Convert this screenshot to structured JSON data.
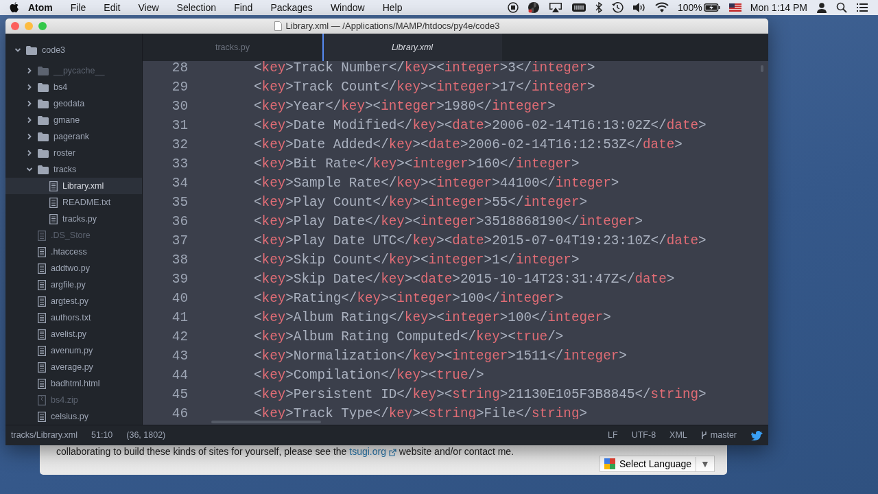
{
  "menu_bar": {
    "app": "Atom",
    "items": [
      "File",
      "Edit",
      "View",
      "Selection",
      "Find",
      "Packages",
      "Window",
      "Help"
    ],
    "battery": "100%",
    "clock": "Mon 1:14 PM"
  },
  "window": {
    "title": "Library.xml — /Applications/MAMP/htdocs/py4e/code3"
  },
  "sidebar": {
    "root": {
      "label": "code3",
      "expanded": true,
      "children": [
        {
          "label": "__pycache__",
          "kind": "folder",
          "expanded": false,
          "dimmed": true,
          "selected": false
        },
        {
          "label": "bs4",
          "kind": "folder",
          "expanded": false,
          "dimmed": false,
          "selected": false
        },
        {
          "label": "geodata",
          "kind": "folder",
          "expanded": false,
          "dimmed": false,
          "selected": false
        },
        {
          "label": "gmane",
          "kind": "folder",
          "expanded": false,
          "dimmed": false,
          "selected": false
        },
        {
          "label": "pagerank",
          "kind": "folder",
          "expanded": false,
          "dimmed": false,
          "selected": false
        },
        {
          "label": "roster",
          "kind": "folder",
          "expanded": false,
          "dimmed": false,
          "selected": false
        },
        {
          "label": "tracks",
          "kind": "folder",
          "expanded": true,
          "dimmed": false,
          "selected": false,
          "children": [
            {
              "label": "Library.xml",
              "kind": "file",
              "dimmed": false,
              "selected": true
            },
            {
              "label": "README.txt",
              "kind": "file",
              "dimmed": false,
              "selected": false
            },
            {
              "label": "tracks.py",
              "kind": "file",
              "dimmed": false,
              "selected": false
            }
          ]
        },
        {
          "label": ".DS_Store",
          "kind": "file",
          "dimmed": true,
          "selected": false
        },
        {
          "label": ".htaccess",
          "kind": "file",
          "dimmed": false,
          "selected": false
        },
        {
          "label": "addtwo.py",
          "kind": "file",
          "dimmed": false,
          "selected": false
        },
        {
          "label": "argfile.py",
          "kind": "file",
          "dimmed": false,
          "selected": false
        },
        {
          "label": "argtest.py",
          "kind": "file",
          "dimmed": false,
          "selected": false
        },
        {
          "label": "authors.txt",
          "kind": "file",
          "dimmed": false,
          "selected": false
        },
        {
          "label": "avelist.py",
          "kind": "file",
          "dimmed": false,
          "selected": false
        },
        {
          "label": "avenum.py",
          "kind": "file",
          "dimmed": false,
          "selected": false
        },
        {
          "label": "average.py",
          "kind": "file",
          "dimmed": false,
          "selected": false
        },
        {
          "label": "badhtml.html",
          "kind": "file",
          "dimmed": false,
          "selected": false
        },
        {
          "label": "bs4.zip",
          "kind": "archive",
          "dimmed": true,
          "selected": false
        },
        {
          "label": "celsius.py",
          "kind": "file",
          "dimmed": false,
          "selected": false
        }
      ]
    }
  },
  "tabs": [
    {
      "label": "tracks.py",
      "selected": false
    },
    {
      "label": "Library.xml",
      "selected": true
    }
  ],
  "editor": {
    "lines": [
      {
        "number": "28",
        "text": "<key>Track Number</key><integer>3</integer>"
      },
      {
        "number": "29",
        "text": "<key>Track Count</key><integer>17</integer>"
      },
      {
        "number": "30",
        "text": "<key>Year</key><integer>1980</integer>"
      },
      {
        "number": "31",
        "text": "<key>Date Modified</key><date>2006-02-14T16:13:02Z</date>"
      },
      {
        "number": "32",
        "text": "<key>Date Added</key><date>2006-02-14T16:12:53Z</date>"
      },
      {
        "number": "33",
        "text": "<key>Bit Rate</key><integer>160</integer>"
      },
      {
        "number": "34",
        "text": "<key>Sample Rate</key><integer>44100</integer>"
      },
      {
        "number": "35",
        "text": "<key>Play Count</key><integer>55</integer>"
      },
      {
        "number": "36",
        "text": "<key>Play Date</key><integer>3518868190</integer>"
      },
      {
        "number": "37",
        "text": "<key>Play Date UTC</key><date>2015-07-04T19:23:10Z</date>"
      },
      {
        "number": "38",
        "text": "<key>Skip Count</key><integer>1</integer>"
      },
      {
        "number": "39",
        "text": "<key>Skip Date</key><date>2015-10-14T23:31:47Z</date>"
      },
      {
        "number": "40",
        "text": "<key>Rating</key><integer>100</integer>"
      },
      {
        "number": "41",
        "text": "<key>Album Rating</key><integer>100</integer>"
      },
      {
        "number": "42",
        "text": "<key>Album Rating Computed</key><true/>"
      },
      {
        "number": "43",
        "text": "<key>Normalization</key><integer>1511</integer>"
      },
      {
        "number": "44",
        "text": "<key>Compilation</key><true/>"
      },
      {
        "number": "45",
        "text": "<key>Persistent ID</key><string>21130E105F3B8845</string>"
      },
      {
        "number": "46",
        "text": "<key>Track Type</key><string>File</string>"
      }
    ]
  },
  "status_bar": {
    "left": [
      "tracks/Library.xml",
      "51:10",
      "(36, 1802)"
    ],
    "right": [
      "LF",
      "UTF-8",
      "XML"
    ],
    "branch": "master"
  },
  "background_page": {
    "text_before": "collaborating to build these kinds of sites for yourself, please see the",
    "link": "tsugi.org",
    "text_after": "website and/or contact me.",
    "language_button": "Select Language",
    "language_caret": "▼"
  }
}
